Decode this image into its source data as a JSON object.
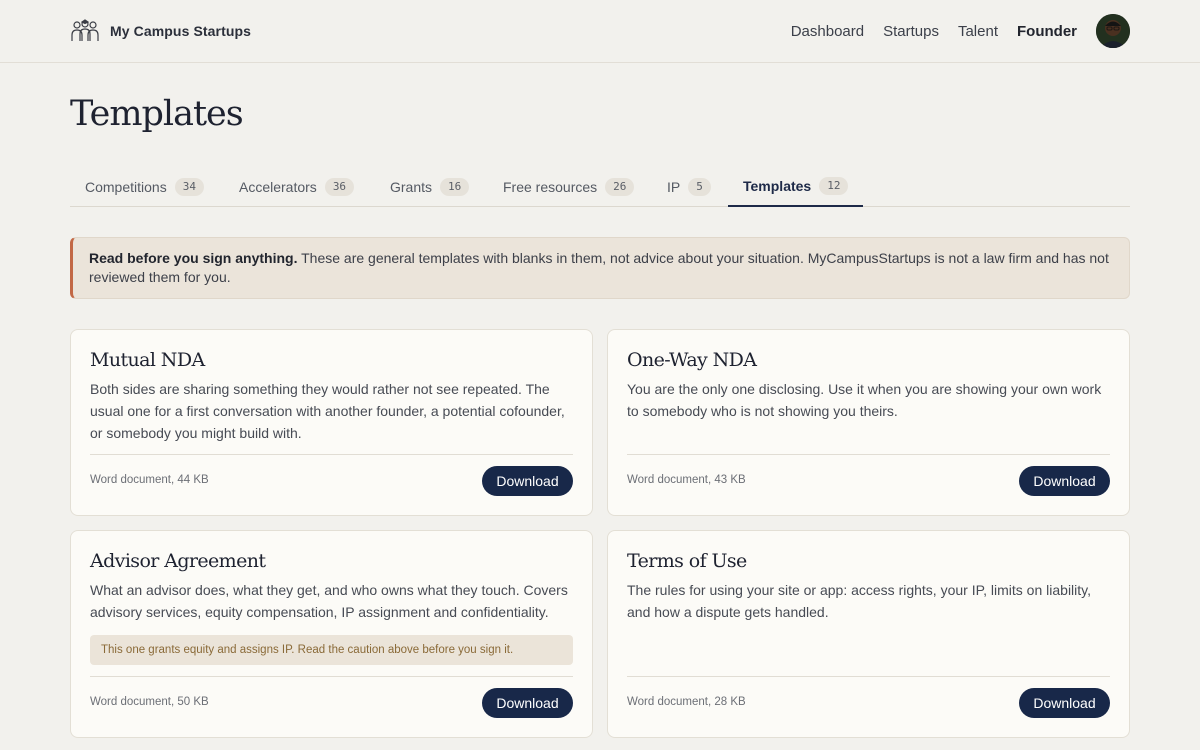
{
  "header": {
    "brand_name": "My Campus Startups",
    "logo_icon": "students-group-icon",
    "nav": [
      {
        "label": "Dashboard",
        "active": false
      },
      {
        "label": "Startups",
        "active": false
      },
      {
        "label": "Talent",
        "active": false
      },
      {
        "label": "Founder",
        "active": true
      }
    ],
    "avatar_icon": "user-avatar"
  },
  "page_title": "Templates",
  "tabs": [
    {
      "label": "Competitions",
      "count": "34",
      "active": false
    },
    {
      "label": "Accelerators",
      "count": "36",
      "active": false
    },
    {
      "label": "Grants",
      "count": "16",
      "active": false
    },
    {
      "label": "Free resources",
      "count": "26",
      "active": false
    },
    {
      "label": "IP",
      "count": "5",
      "active": false
    },
    {
      "label": "Templates",
      "count": "12",
      "active": true
    }
  ],
  "caution": {
    "bold": "Read before you sign anything.",
    "text": " These are general templates with blanks in them, not advice about your situation. MyCampusStartups is not a law firm and has not reviewed them for you."
  },
  "cards": [
    {
      "title": "Mutual NDA",
      "description": "Both sides are sharing something they would rather not see repeated. The usual one for a first conversation with another founder, a potential cofounder, or somebody you might build with.",
      "meta": "Word document, 44 KB",
      "button": "Download"
    },
    {
      "title": "One-Way NDA",
      "description": "You are the only one disclosing. Use it when you are showing your own work to somebody who is not showing you theirs.",
      "meta": "Word document, 43 KB",
      "button": "Download"
    },
    {
      "title": "Advisor Agreement",
      "description": "What an advisor does, what they get, and who owns what they touch. Covers advisory services, equity compensation, IP assignment and confidentiality.",
      "note": "This one grants equity and assigns IP. Read the caution above before you sign it.",
      "meta": "Word document, 50 KB",
      "button": "Download"
    },
    {
      "title": "Terms of Use",
      "description": "The rules for using your site or app: access rights, your IP, limits on liability, and how a dispute gets handled.",
      "meta": "Word document, 28 KB",
      "button": "Download"
    }
  ],
  "colors": {
    "background": "#f2f1ed",
    "accent": "#182849",
    "caution_border": "#c26845",
    "note_text": "#8a6a38"
  }
}
